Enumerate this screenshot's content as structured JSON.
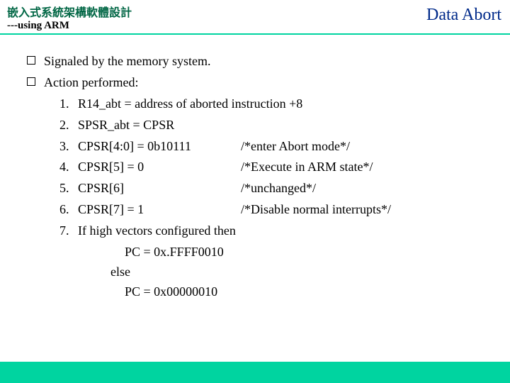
{
  "header": {
    "title_main": "嵌入式系統架構軟體設計",
    "title_sub": "---using ARM",
    "title_right": "Data Abort"
  },
  "bullets": {
    "b1": "Signaled by the memory system.",
    "b2": "Action performed:"
  },
  "steps": {
    "s1": {
      "n": "1.",
      "text": "R14_abt = address of aborted instruction +8"
    },
    "s2": {
      "n": "2.",
      "text": "SPSR_abt = CPSR"
    },
    "s3": {
      "n": "3.",
      "left": "CPSR[4:0] = 0b10111",
      "right": "/*enter Abort mode*/"
    },
    "s4": {
      "n": "4.",
      "left": "CPSR[5] = 0",
      "right": "/*Execute in ARM state*/"
    },
    "s5": {
      "n": "5.",
      "left": "CPSR[6]",
      "right": "/*unchanged*/"
    },
    "s6": {
      "n": "6.",
      "left": "CPSR[7] = 1",
      "right": "/*Disable normal interrupts*/"
    },
    "s7": {
      "n": "7.",
      "text": "If high vectors configured then"
    }
  },
  "tail": {
    "t1": "PC = 0x.FFFF0010",
    "t2": "else",
    "t3": "PC = 0x00000010"
  }
}
